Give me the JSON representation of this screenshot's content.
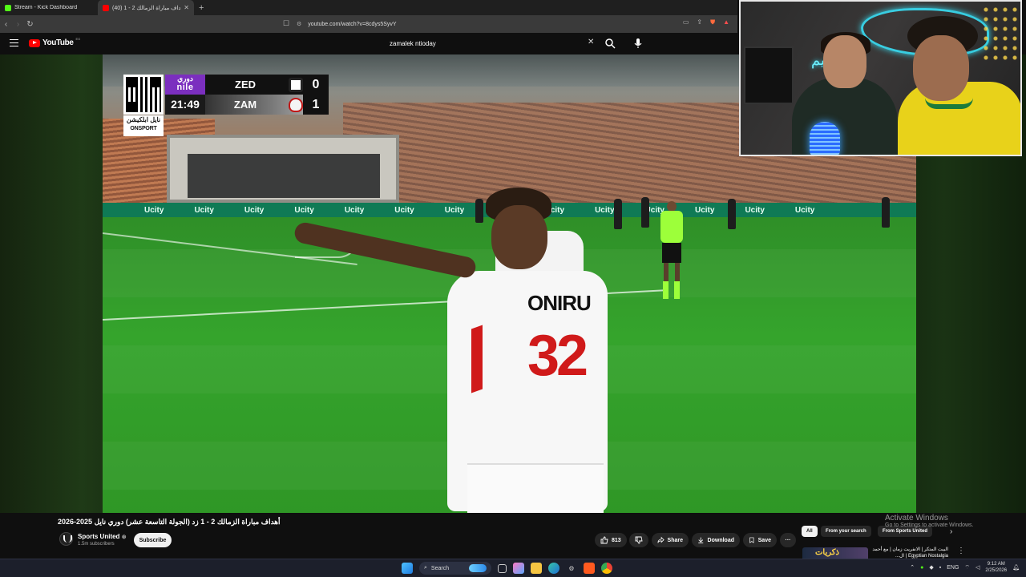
{
  "browser": {
    "tabs": [
      {
        "title": "Stream - Kick Dashboard",
        "active": false
      },
      {
        "title": "أهداف مباراة الزمالك 2 - 1 (40)",
        "active": true
      }
    ],
    "new_tab": "+",
    "url": "youtube.com/watch?v=8cdys5SyvY"
  },
  "youtube": {
    "logo_text": "YouTube",
    "logo_country": "EG",
    "search_query": "zamalek ntioday"
  },
  "scoreboard": {
    "league_ar": "دوري",
    "league_en": "nile",
    "clock": "21:49",
    "broadcaster_ar": "نايل ابلكيشن",
    "broadcaster_en": "ONSPORT",
    "teams": [
      {
        "name": "ZED",
        "score": "0"
      },
      {
        "name": "ZAM",
        "score": "1"
      }
    ]
  },
  "scene": {
    "ad_board": [
      "Ucity",
      "Ucity",
      "Ucity",
      "Ucity",
      "Ucity",
      "Ucity",
      "Ucity",
      "Ucity",
      "Ucity",
      "Ucity",
      "Ucity",
      "Ucity",
      "Ucity",
      "Ucity"
    ],
    "player_name": "ONIRU",
    "player_number": "32",
    "webcam_sign": "كيم"
  },
  "video_info": {
    "title": "أهداف مباراة الزمالك 2 - 1 زد (الجولة التاسعة عشر) دوري نايل 2025-2026",
    "channel": "Sports United",
    "subscribers": "1.5m subscribers",
    "subscribe": "Subscribe",
    "likes": "813",
    "share": "Share",
    "download": "Download",
    "save": "Save",
    "more": "···"
  },
  "sidebar": {
    "chips": [
      "All",
      "From your search",
      "From Sports United"
    ],
    "rec_thumb_text": "ذكريات",
    "rec_title": "البيت المتكر | الانفريت زمان | مع أحمد Egyptian Nostalgia | ال..."
  },
  "windows": {
    "activate_title": "Activate Windows",
    "activate_sub": "Go to Settings to activate Windows.",
    "taskbar_search": "Search",
    "lang": "ENG",
    "time": "9:12 AM",
    "date": "2/25/2026"
  }
}
